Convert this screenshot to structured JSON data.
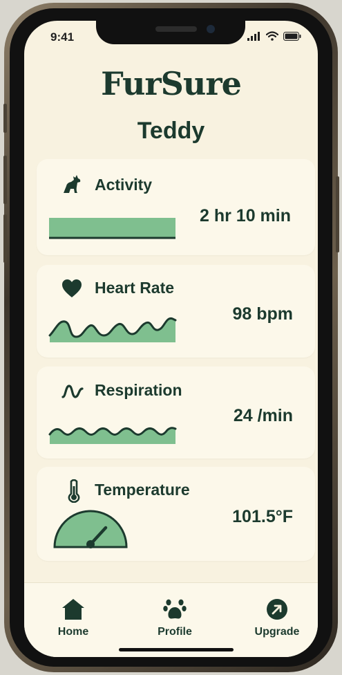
{
  "status_bar": {
    "time": "9:41"
  },
  "app": {
    "title": "FurSure"
  },
  "pet": {
    "name": "Teddy"
  },
  "cards": {
    "activity": {
      "title": "Activity",
      "value": "2 hr 10 min",
      "icon": "dog-icon"
    },
    "heart_rate": {
      "title": "Heart Rate",
      "value": "98 bpm",
      "icon": "heart-icon"
    },
    "respiration": {
      "title": "Respiration",
      "value": "24 /min",
      "icon": "wave-icon"
    },
    "temperature": {
      "title": "Temperature",
      "value": "101.5°F",
      "icon": "thermometer-icon"
    }
  },
  "tabs": [
    {
      "label": "Home",
      "icon": "home-icon"
    },
    {
      "label": "Profile",
      "icon": "paw-icon"
    },
    {
      "label": "Upgrade",
      "icon": "arrow-up-right-icon"
    }
  ],
  "colors": {
    "primary": "#1c3a2e",
    "accent": "#7fbf8f",
    "background": "#f8f2e0",
    "card": "#fcf8ea"
  }
}
